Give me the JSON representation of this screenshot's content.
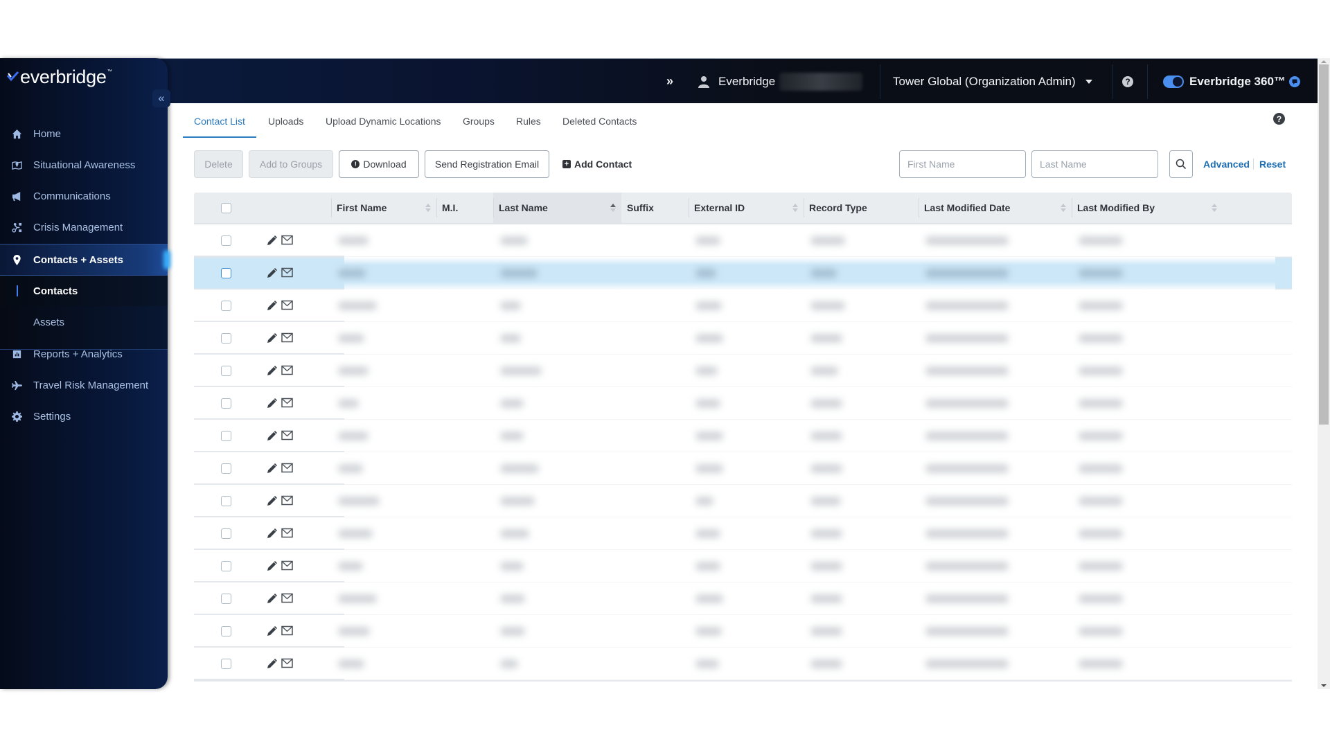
{
  "brand": {
    "logo_text": "everbridge",
    "logo_tm": "™"
  },
  "header": {
    "expand_icon": "»",
    "user_name": "Everbridge",
    "org_label": "Tower Global (Organization Admin)",
    "help_icon": "?",
    "toggle_on": true,
    "product_label": "Everbridge 360™"
  },
  "sidebar": {
    "collapse_icon": "«",
    "items": [
      {
        "label": "Home",
        "icon": "home-icon"
      },
      {
        "label": "Situational Awareness",
        "icon": "map-pin-icon"
      },
      {
        "label": "Communications",
        "icon": "megaphone-icon"
      },
      {
        "label": "Crisis Management",
        "icon": "route-icon"
      },
      {
        "label": "Contacts + Assets",
        "icon": "location-pin-icon",
        "active": true
      },
      {
        "label": "Reports + Analytics",
        "icon": "bar-chart-icon"
      },
      {
        "label": "Travel Risk Management",
        "icon": "plane-icon"
      },
      {
        "label": "Settings",
        "icon": "gear-icon"
      }
    ],
    "subitems": [
      {
        "label": "Contacts",
        "active": true
      },
      {
        "label": "Assets"
      }
    ]
  },
  "tabs": [
    {
      "label": "Contact List",
      "active": true
    },
    {
      "label": "Uploads"
    },
    {
      "label": "Upload Dynamic Locations"
    },
    {
      "label": "Groups"
    },
    {
      "label": "Rules"
    },
    {
      "label": "Deleted Contacts"
    }
  ],
  "toolbar": {
    "delete_label": "Delete",
    "add_to_groups_label": "Add to Groups",
    "download_label": "Download",
    "send_registration_label": "Send Registration Email",
    "add_contact_label": "Add Contact",
    "first_name_placeholder": "First Name",
    "first_name_value": "",
    "last_name_placeholder": "Last Name",
    "last_name_value": "",
    "advanced_label": "Advanced",
    "reset_label": "Reset"
  },
  "table": {
    "columns": [
      {
        "label": "First Name",
        "sortable": true,
        "sort": "none"
      },
      {
        "label": "M.I.",
        "sortable": false
      },
      {
        "label": "Last Name",
        "sortable": true,
        "sort": "asc"
      },
      {
        "label": "Suffix",
        "sortable": false
      },
      {
        "label": "External ID",
        "sortable": true,
        "sort": "none"
      },
      {
        "label": "Record Type",
        "sortable": false
      },
      {
        "label": "Last Modified Date",
        "sortable": true,
        "sort": "none"
      },
      {
        "label": "Last Modified By",
        "sortable": true,
        "sort": "none"
      }
    ],
    "row_cells_redacted": true,
    "rows": [
      {
        "checked": false,
        "selected": false
      },
      {
        "checked": false,
        "selected": true
      },
      {
        "checked": false,
        "selected": false
      },
      {
        "checked": false,
        "selected": false
      },
      {
        "checked": false,
        "selected": false
      },
      {
        "checked": false,
        "selected": false
      },
      {
        "checked": false,
        "selected": false
      },
      {
        "checked": false,
        "selected": false
      },
      {
        "checked": false,
        "selected": false
      },
      {
        "checked": false,
        "selected": false
      },
      {
        "checked": false,
        "selected": false
      },
      {
        "checked": false,
        "selected": false
      },
      {
        "checked": false,
        "selected": false
      },
      {
        "checked": false,
        "selected": false
      }
    ]
  },
  "colors": {
    "accent": "#2a7bbf",
    "link": "#1f6fb5",
    "selected_row": "#cce7f8",
    "sidebar_bg": "#08183a",
    "header_bg": "#0a0e17",
    "toggle": "#4a8ff0"
  }
}
